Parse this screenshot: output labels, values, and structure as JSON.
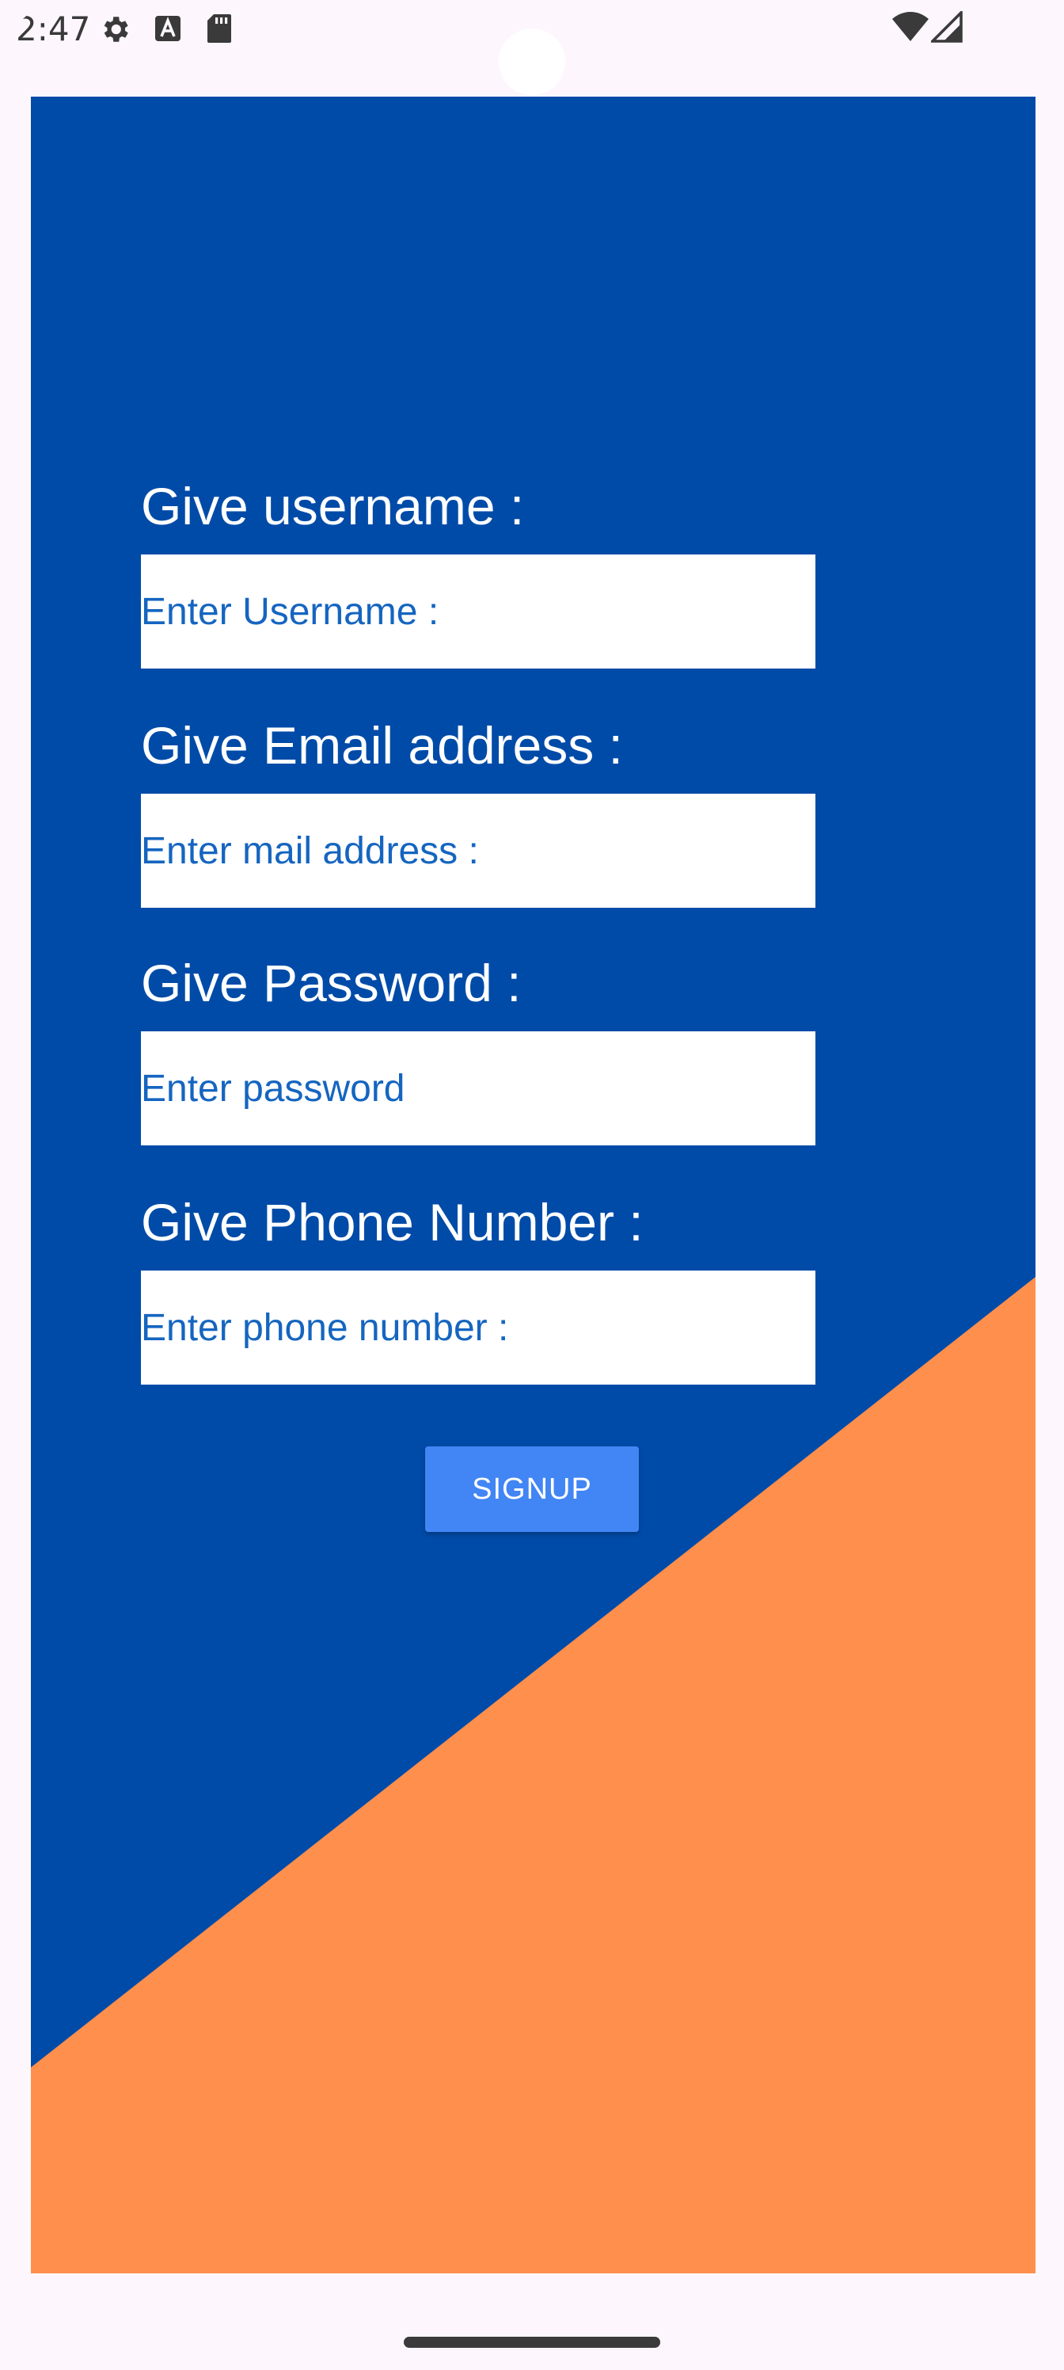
{
  "status_bar": {
    "time": "2:47",
    "icons_left": [
      "gear-icon",
      "font-a-icon",
      "sd-card-icon"
    ],
    "icons_right": [
      "wifi-icon",
      "signal-icon"
    ]
  },
  "colors": {
    "app_background": "#004ba8",
    "accent_triangle": "#ff8f4c",
    "label_text": "#ffffff",
    "input_text": "#1565c0",
    "button_background": "#4285f4"
  },
  "form": {
    "username": {
      "label": "Give username :",
      "placeholder": "Enter Username :"
    },
    "email": {
      "label": "Give Email address :",
      "placeholder": "Enter mail address :"
    },
    "password": {
      "label": "Give Password :",
      "placeholder": "Enter password"
    },
    "phone": {
      "label": "Give Phone Number :",
      "placeholder": "Enter phone number :"
    },
    "signup_label": "SIGNUP"
  }
}
